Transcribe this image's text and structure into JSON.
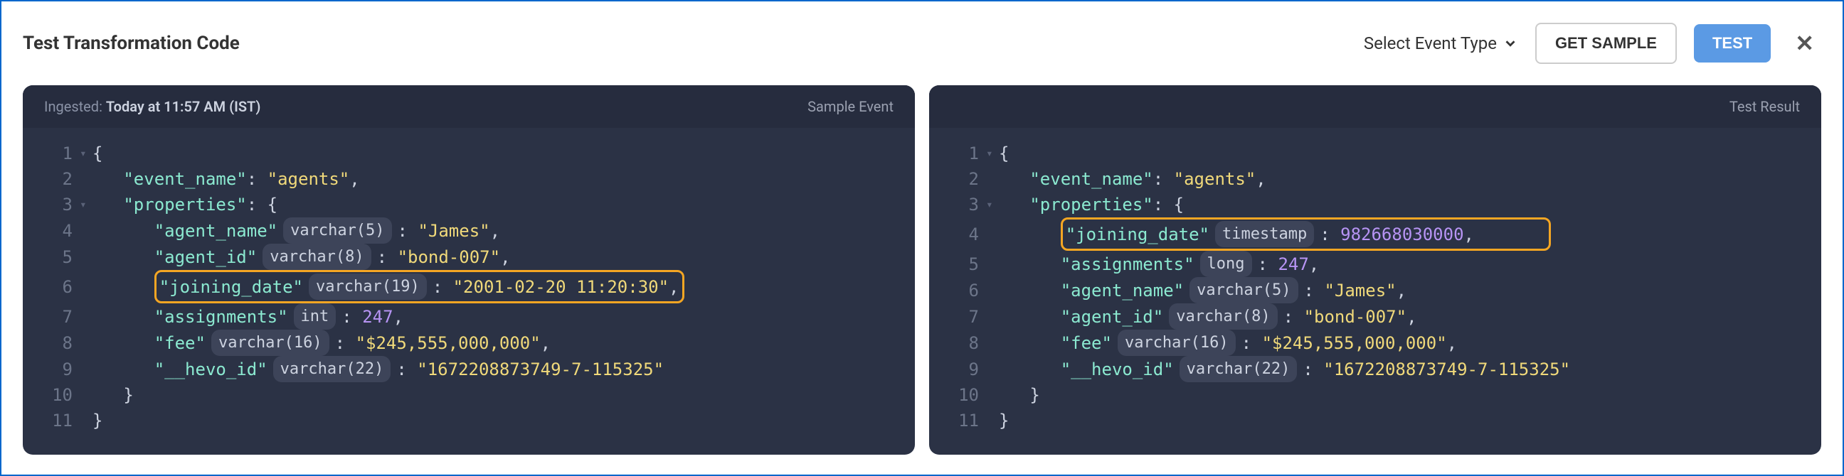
{
  "header": {
    "title": "Test Transformation Code",
    "select_label": "Select Event Type",
    "get_sample": "GET SAMPLE",
    "test": "TEST"
  },
  "left_panel": {
    "ingested_label": "Ingested:",
    "ingested_value": "Today at 11:57 AM (IST)",
    "right_label": "Sample Event",
    "lines": {
      "l1": "{",
      "l2_key": "\"event_name\"",
      "l2_val": "\"agents\"",
      "l3_key": "\"properties\"",
      "l4_key": "\"agent_name\"",
      "l4_type": "varchar(5)",
      "l4_val": "\"James\"",
      "l5_key": "\"agent_id\"",
      "l5_type": "varchar(8)",
      "l5_val": "\"bond-007\"",
      "l6_key": "\"joining_date\"",
      "l6_type": "varchar(19)",
      "l6_val": "\"2001-02-20 11:20:30\"",
      "l7_key": "\"assignments\"",
      "l7_type": "int",
      "l7_val": "247",
      "l8_key": "\"fee\"",
      "l8_type": "varchar(16)",
      "l8_val": "\"$245,555,000,000\"",
      "l9_key": "\"__hevo_id\"",
      "l9_type": "varchar(22)",
      "l9_val": "\"1672208873749-7-115325\""
    }
  },
  "right_panel": {
    "right_label": "Test Result",
    "lines": {
      "l1": "{",
      "l2_key": "\"event_name\"",
      "l2_val": "\"agents\"",
      "l3_key": "\"properties\"",
      "l4_key": "\"joining_date\"",
      "l4_type": "timestamp",
      "l4_val": "982668030000",
      "l5_key": "\"assignments\"",
      "l5_type": "long",
      "l5_val": "247",
      "l6_key": "\"agent_name\"",
      "l6_type": "varchar(5)",
      "l6_val": "\"James\"",
      "l7_key": "\"agent_id\"",
      "l7_type": "varchar(8)",
      "l7_val": "\"bond-007\"",
      "l8_key": "\"fee\"",
      "l8_type": "varchar(16)",
      "l8_val": "\"$245,555,000,000\"",
      "l9_key": "\"__hevo_id\"",
      "l9_type": "varchar(22)",
      "l9_val": "\"1672208873749-7-115325\""
    }
  },
  "ln": {
    "n1": "1",
    "n2": "2",
    "n3": "3",
    "n4": "4",
    "n5": "5",
    "n6": "6",
    "n7": "7",
    "n8": "8",
    "n9": "9",
    "n10": "10",
    "n11": "11"
  }
}
